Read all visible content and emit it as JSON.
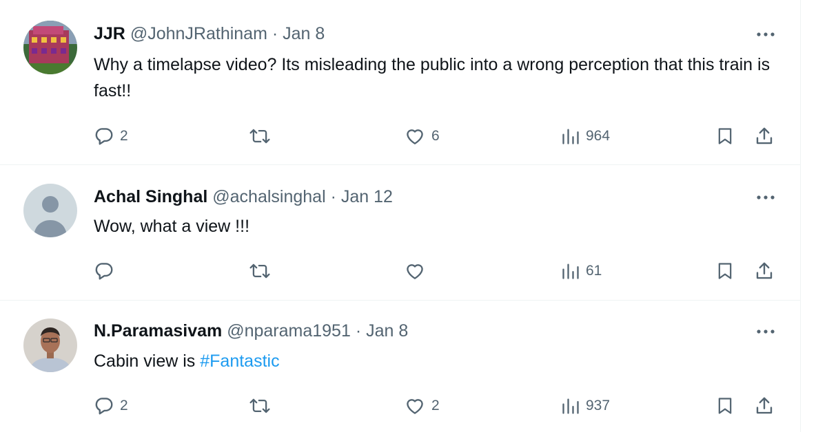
{
  "tweets": [
    {
      "name": "JJR",
      "handle": "@JohnJRathinam",
      "separator": "·",
      "date": "Jan 8",
      "text": "Why a timelapse video? Its misleading the public into a wrong perception that this train is fast!!",
      "replies": "2",
      "retweets": "",
      "likes": "6",
      "views": "964"
    },
    {
      "name": "Achal Singhal",
      "handle": "@achalsinghal",
      "separator": "·",
      "date": "Jan 12",
      "text": "Wow, what a view !!!",
      "replies": "",
      "retweets": "",
      "likes": "",
      "views": "61"
    },
    {
      "name": "N.Paramasivam",
      "handle": "@nparama1951",
      "separator": "·",
      "date": "Jan 8",
      "text_prefix": "Cabin view is ",
      "hashtag": "#Fantastic",
      "replies": "2",
      "retweets": "",
      "likes": "2",
      "views": "937"
    }
  ],
  "icons": {
    "reply": "speech-bubble",
    "retweet": "retweet-arrows",
    "like": "heart",
    "views": "bar-chart",
    "bookmark": "bookmark",
    "share": "upload-arrow",
    "more": "three-dots"
  },
  "colors": {
    "text": "#0f1419",
    "secondary": "#536471",
    "link": "#1d9bf0",
    "border": "#eff3f4"
  }
}
